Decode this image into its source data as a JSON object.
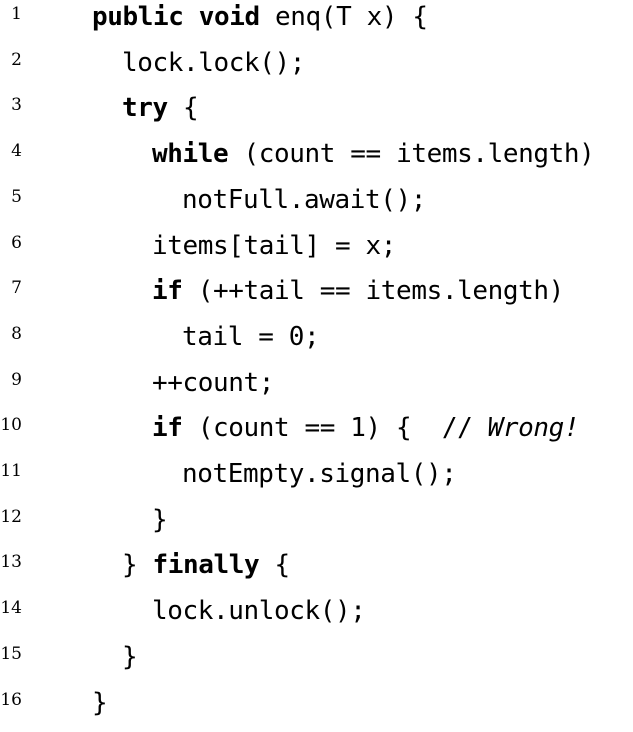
{
  "code_listing": {
    "lines": [
      {
        "no": "1",
        "indent": 0,
        "segments": [
          {
            "t": "public void",
            "k": "kw"
          },
          {
            "t": " enq(T x) {",
            "k": ""
          }
        ]
      },
      {
        "no": "2",
        "indent": 1,
        "segments": [
          {
            "t": "lock.lock();",
            "k": ""
          }
        ]
      },
      {
        "no": "3",
        "indent": 1,
        "segments": [
          {
            "t": "try",
            "k": "kw"
          },
          {
            "t": " {",
            "k": ""
          }
        ]
      },
      {
        "no": "4",
        "indent": 2,
        "segments": [
          {
            "t": "while",
            "k": "kw"
          },
          {
            "t": " (count == items.length)",
            "k": ""
          }
        ]
      },
      {
        "no": "5",
        "indent": 3,
        "segments": [
          {
            "t": "notFull.await();",
            "k": ""
          }
        ]
      },
      {
        "no": "6",
        "indent": 2,
        "segments": [
          {
            "t": "items[tail] = x;",
            "k": ""
          }
        ]
      },
      {
        "no": "7",
        "indent": 2,
        "segments": [
          {
            "t": "if",
            "k": "kw"
          },
          {
            "t": " (++tail == items.length)",
            "k": ""
          }
        ]
      },
      {
        "no": "8",
        "indent": 3,
        "segments": [
          {
            "t": "tail = 0;",
            "k": ""
          }
        ]
      },
      {
        "no": "9",
        "indent": 2,
        "segments": [
          {
            "t": "++count;",
            "k": ""
          }
        ]
      },
      {
        "no": "10",
        "indent": 2,
        "segments": [
          {
            "t": "if",
            "k": "kw"
          },
          {
            "t": " (count == 1) {  // ",
            "k": ""
          },
          {
            "t": "Wrong!",
            "k": "cm"
          }
        ]
      },
      {
        "no": "11",
        "indent": 3,
        "segments": [
          {
            "t": "notEmpty.signal();",
            "k": ""
          }
        ]
      },
      {
        "no": "12",
        "indent": 2,
        "segments": [
          {
            "t": "}",
            "k": ""
          }
        ]
      },
      {
        "no": "13",
        "indent": 1,
        "segments": [
          {
            "t": "} ",
            "k": ""
          },
          {
            "t": "finally",
            "k": "kw"
          },
          {
            "t": " {",
            "k": ""
          }
        ]
      },
      {
        "no": "14",
        "indent": 2,
        "segments": [
          {
            "t": "lock.unlock();",
            "k": ""
          }
        ]
      },
      {
        "no": "15",
        "indent": 1,
        "segments": [
          {
            "t": "}",
            "k": ""
          }
        ]
      },
      {
        "no": "16",
        "indent": 0,
        "segments": [
          {
            "t": "}",
            "k": ""
          }
        ]
      }
    ]
  }
}
